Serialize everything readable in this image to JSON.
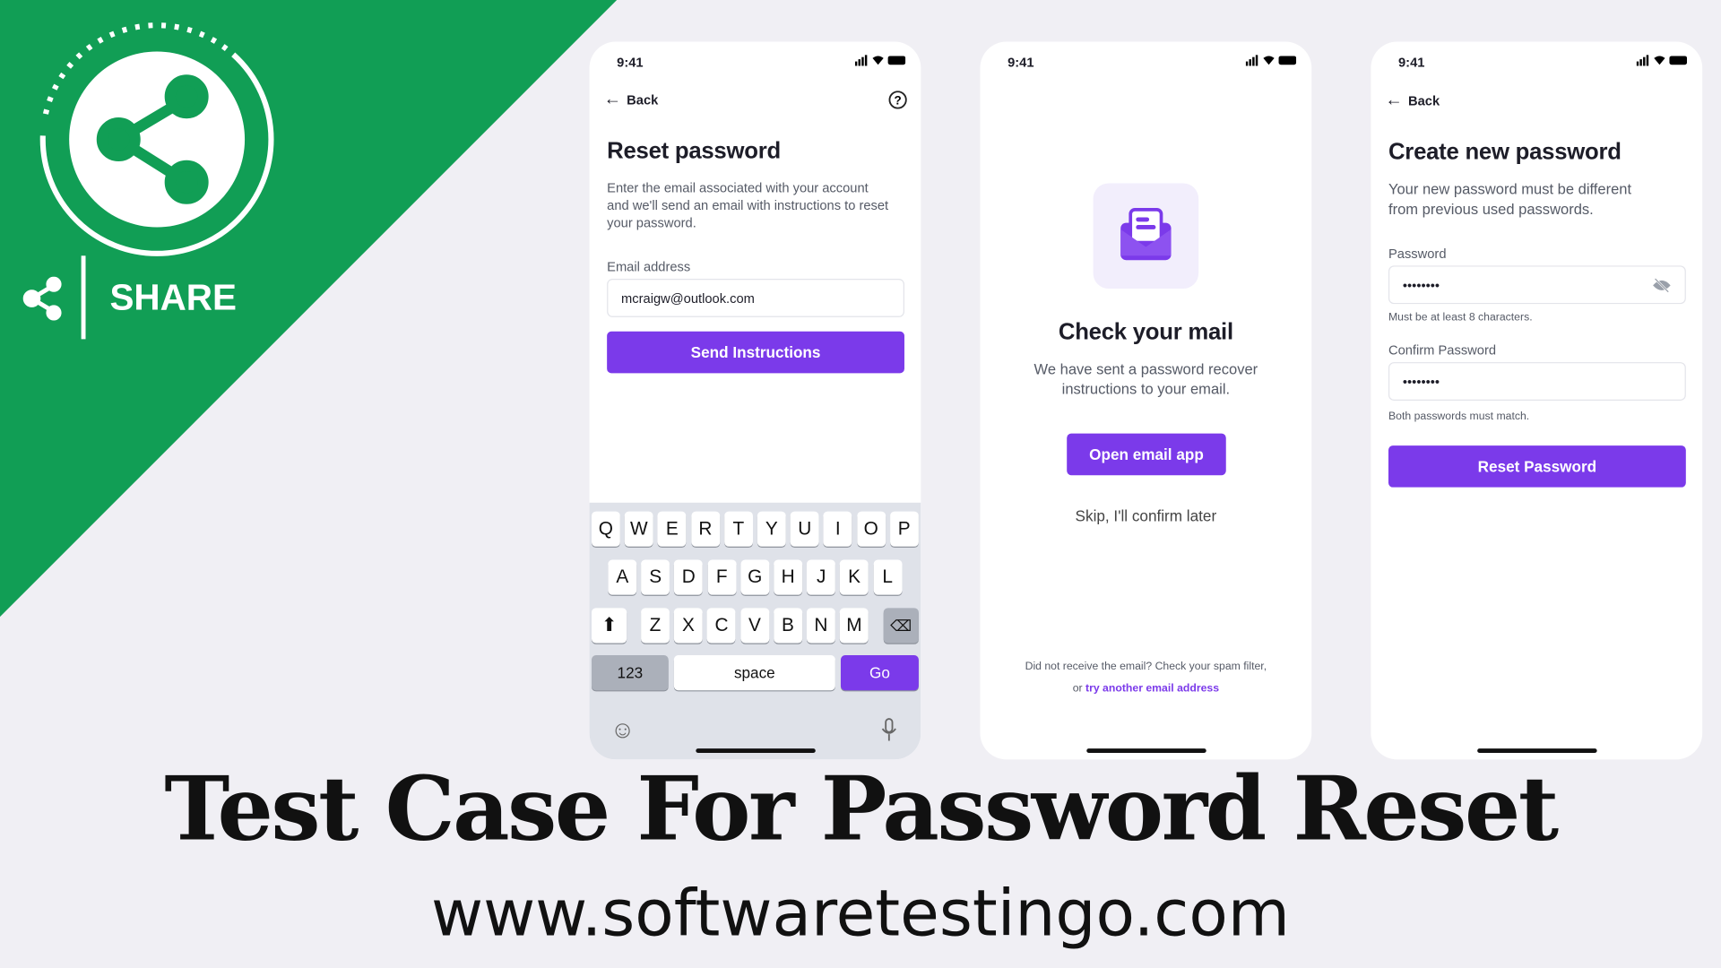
{
  "colors": {
    "brand_green": "#119e55",
    "accent_purple": "#7b3aea",
    "background": "#f0eff4"
  },
  "badge": {
    "label": "SHARE",
    "icon": "share-icon"
  },
  "title": "Test Case For Password Reset",
  "website": "www.softwaretestingo.com",
  "screens": {
    "reset": {
      "time": "9:41",
      "back": "Back",
      "help_icon": "question-circle-icon",
      "heading": "Reset password",
      "description": "Enter the email associated with your account and we'll send an email with instructions to reset your password.",
      "email_label": "Email address",
      "email_value": "mcraigw@outlook.com",
      "button": "Send Instructions",
      "keyboard": {
        "row1": [
          "Q",
          "W",
          "E",
          "R",
          "T",
          "Y",
          "U",
          "I",
          "O",
          "P"
        ],
        "row2": [
          "A",
          "S",
          "D",
          "F",
          "G",
          "H",
          "J",
          "K",
          "L"
        ],
        "row3": [
          "Z",
          "X",
          "C",
          "V",
          "B",
          "N",
          "M"
        ],
        "numbers": "123",
        "space": "space",
        "go": "Go"
      }
    },
    "check_mail": {
      "time": "9:41",
      "heading": "Check your mail",
      "description": "We have sent a password recover instructions to your email.",
      "button": "Open email app",
      "skip": "Skip, I'll confirm later",
      "footer_text": "Did not receive the email? Check your spam filter,",
      "footer_or": "or",
      "footer_link": "try another email address"
    },
    "new_password": {
      "time": "9:41",
      "back": "Back",
      "heading": "Create new password",
      "description": "Your new password must be different from previous used passwords.",
      "password_label": "Password",
      "password_value": "••••••••",
      "password_hint": "Must be at least 8 characters.",
      "confirm_label": "Confirm Password",
      "confirm_value": "••••••••",
      "confirm_hint": "Both passwords must match.",
      "button": "Reset Password"
    }
  }
}
